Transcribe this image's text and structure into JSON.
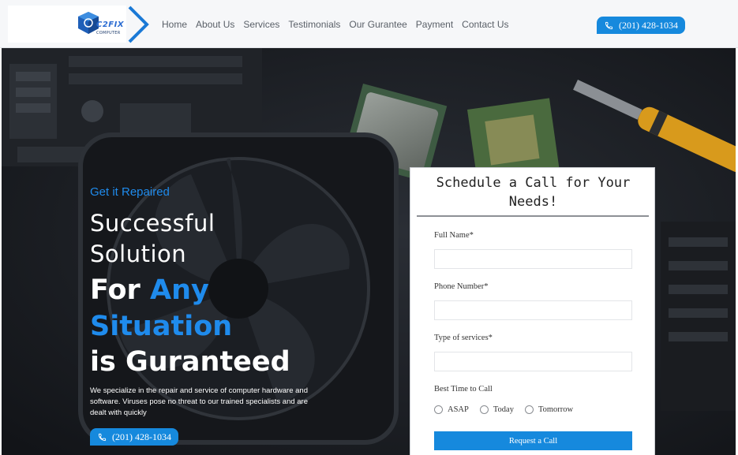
{
  "brand": {
    "logo_text": "C2FIX",
    "logo_subtext": "COMPUTER"
  },
  "nav": {
    "items": [
      {
        "label": "Home"
      },
      {
        "label": "About Us"
      },
      {
        "label": "Services"
      },
      {
        "label": "Testimonials"
      },
      {
        "label": "Our Gurantee"
      },
      {
        "label": "Payment"
      },
      {
        "label": "Contact Us"
      }
    ]
  },
  "header": {
    "phone_label": "(201) 428-1034"
  },
  "hero": {
    "eyebrow": "Get it Repaired",
    "line1": "Successful",
    "line2": "Solution",
    "line3_prefix": "For ",
    "line3_highlight": "Any",
    "line4": "Situation",
    "line5": "is Guranteed",
    "description": "We specialize in the repair and service of computer hardware and software. Viruses pose no threat to our trained specialists and are dealt with quickly",
    "phone_label": "(201) 428-1034"
  },
  "form": {
    "title": "Schedule a Call for Your Needs!",
    "full_name_label": "Full Name*",
    "phone_label": "Phone Number*",
    "service_label": "Type of services*",
    "best_time_label": "Best Time to Call",
    "options": [
      {
        "label": "ASAP"
      },
      {
        "label": "Today"
      },
      {
        "label": "Tomorrow"
      }
    ],
    "submit_label": "Request a Call"
  },
  "colors": {
    "accent": "#1689dd",
    "headline_blue": "#1f8bec",
    "hero_bg": "#1c1f24",
    "header_bg": "#f6f7f9"
  }
}
